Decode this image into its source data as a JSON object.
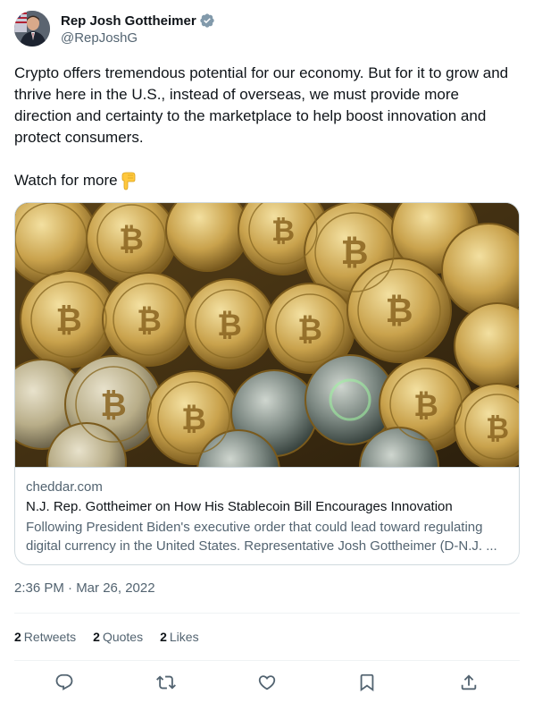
{
  "author": {
    "display_name": "Rep Josh Gottheimer",
    "handle": "@RepJoshG",
    "verified_icon": "verified-badge-icon",
    "avatar": "avatar"
  },
  "tweet": {
    "text": "Crypto offers tremendous potential for our economy. But for it to grow and thrive here in the U.S., instead of overseas, we must provide more direction and certainty to the marketplace to help boost innovation and protect consumers.",
    "watch_text": "Watch for more",
    "emoji": "pointing-down-emoji"
  },
  "card": {
    "image": "bitcoin-coins-image",
    "domain": "cheddar.com",
    "title": "N.J. Rep. Gottheimer on How His Stablecoin Bill Encourages Innovation",
    "description": "Following President Biden's executive order that could lead toward regulating digital currency in the United States. Representative Josh Gottheimer (D-N.J. ..."
  },
  "timestamp": "2:36 PM · Mar 26, 2022",
  "stats": {
    "retweets_count": "2",
    "retweets_label": "Retweets",
    "quotes_count": "2",
    "quotes_label": "Quotes",
    "likes_count": "2",
    "likes_label": "Likes"
  },
  "actions": [
    "reply-icon",
    "retweet-icon",
    "like-icon",
    "bookmark-icon",
    "share-icon"
  ],
  "colors": {
    "text_primary": "#0f1419",
    "text_secondary": "#536471",
    "border": "#cfd9de",
    "verified": "#829aab"
  }
}
